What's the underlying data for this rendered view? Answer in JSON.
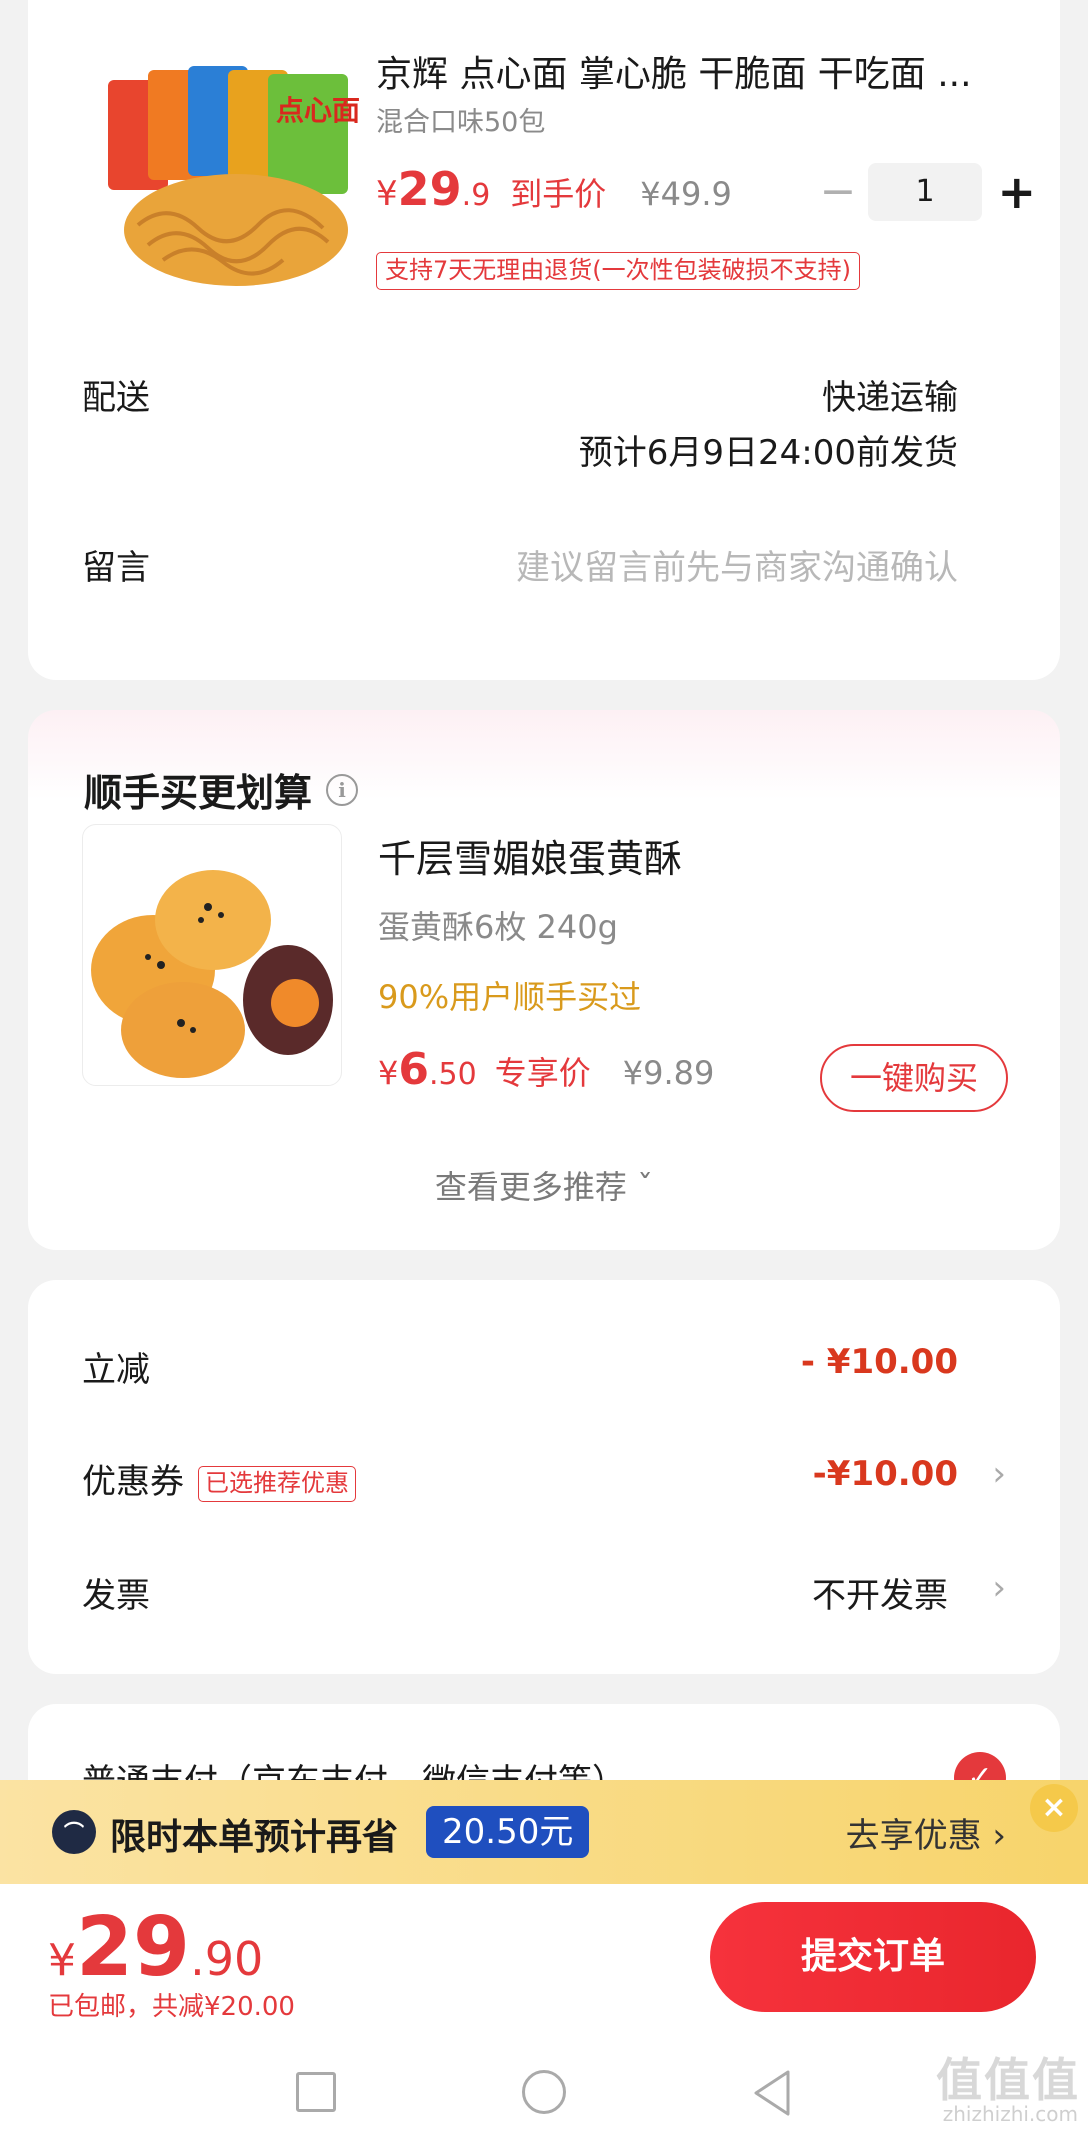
{
  "product": {
    "title": "京辉 点心面 掌心脆 干脆面 干吃面 ...",
    "spec": "混合口味50包",
    "price_symbol": "¥",
    "price_int": "29",
    "price_dec": ".9",
    "price_label": "到手价",
    "original_price": "¥49.9",
    "quantity": "1",
    "minus_symbol": "−",
    "plus_symbol": "+",
    "return_policy": "支持7天无理由退货(一次性包装破损不支持)",
    "package_text": "点心面"
  },
  "delivery": {
    "label": "配送",
    "method": "快递运输",
    "estimate": "预计6月9日24:00前发货"
  },
  "message": {
    "label": "留言",
    "placeholder": "建议留言前先与商家沟通确认"
  },
  "addon": {
    "title": "顺手买更划算",
    "info_symbol": "i",
    "name": "千层雪媚娘蛋黄酥",
    "spec": "蛋黄酥6枚 240g",
    "social_proof": "90%用户顺手买过",
    "price_symbol": "¥",
    "price_int": "6",
    "price_dec": ".50",
    "price_label": "专享价",
    "original_price": "¥9.89",
    "buy_button": "一键购买",
    "more_link": "查看更多推荐 ˇ"
  },
  "discounts": {
    "instant_label": "立减",
    "instant_value": "- ¥10.00",
    "coupon_label": "优惠券",
    "coupon_tag": "已选推荐优惠",
    "coupon_value": "-¥10.00",
    "invoice_label": "发票",
    "invoice_value": "不开发票",
    "chevron": "›"
  },
  "payment": {
    "label": "普通支付（京东支付、微信支付等）",
    "check_symbol": "✓"
  },
  "promo": {
    "logo_symbol": "⌒",
    "text": "限时本单预计再省",
    "amount": "20.50元",
    "link": "去享优惠 ›",
    "close_symbol": "×"
  },
  "summary": {
    "currency": "¥",
    "total_int": "29",
    "total_dec": ".90",
    "shipping_note": "已包邮，共减¥20.00",
    "submit_button": "提交订单"
  },
  "watermark": {
    "main": "值值值",
    "sub": "zhizhizhi.com"
  },
  "colors": {
    "accent_red": "#e4393c",
    "promo_yellow": "#f7d46b",
    "social_orange": "#d99a1c",
    "badge_blue": "#1f4fbf"
  },
  "icons": {
    "info": "info-circle-icon",
    "chevron": "chevron-right-icon",
    "check": "check-circle-icon",
    "close": "close-icon",
    "nav_recent": "recent-apps-icon",
    "nav_home": "home-icon",
    "nav_back": "back-icon"
  }
}
